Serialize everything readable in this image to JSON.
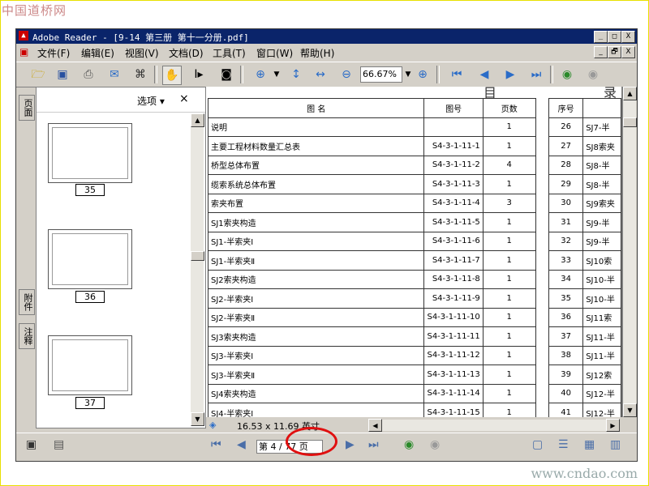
{
  "watermark_top": "中国道桥网",
  "watermark_bottom": "www.cndao.com",
  "window": {
    "title": "Adobe Reader - [9-14  第三册  第十一分册.pdf]",
    "controls": [
      "_",
      "□",
      "X"
    ],
    "doc_controls": [
      "_",
      "🗗",
      "X"
    ]
  },
  "menu": [
    "文件(F)",
    "编辑(E)",
    "视图(V)",
    "文档(D)",
    "工具(T)",
    "窗口(W)",
    "帮助(H)"
  ],
  "toolbar": {
    "zoom_value": "66.67%",
    "icons": [
      "open-folder-icon",
      "save-icon",
      "print-icon",
      "email-icon",
      "search-binoculars-icon",
      "hand-tool-icon",
      "select-text-icon",
      "snapshot-icon",
      "zoom-in-tool-icon",
      "fit-page-icon",
      "fit-width-icon",
      "zoom-out-icon",
      "zoom-in-icon",
      "first-page-icon",
      "previous-page-icon",
      "next-page-icon",
      "last-page-icon",
      "go-back-icon",
      "go-forward-icon"
    ]
  },
  "left_tabs": [
    "页面",
    "附件",
    "注释"
  ],
  "thumb_pane": {
    "options_label": "选项 ▾",
    "close_label": "×",
    "thumbs": [
      "35",
      "36",
      "37"
    ]
  },
  "toc": {
    "header_chars": [
      "目",
      "录"
    ],
    "columns": {
      "name": "图          名",
      "drawing_no": "图号",
      "pages": "页数",
      "seq": "序号"
    },
    "rows": [
      {
        "name": "说明",
        "no": "",
        "pages": "1",
        "seq": "26",
        "name2": "SJ7-半"
      },
      {
        "name": "主要工程材料数量汇总表",
        "no": "S4-3-1-11-1",
        "pages": "1",
        "seq": "27",
        "name2": "SJ8索夹"
      },
      {
        "name": "桥型总体布置",
        "no": "S4-3-1-11-2",
        "pages": "4",
        "seq": "28",
        "name2": "SJ8-半"
      },
      {
        "name": "缆索系统总体布置",
        "no": "S4-3-1-11-3",
        "pages": "1",
        "seq": "29",
        "name2": "SJ8-半"
      },
      {
        "name": "索夹布置",
        "no": "S4-3-1-11-4",
        "pages": "3",
        "seq": "30",
        "name2": "SJ9索夹"
      },
      {
        "name": "SJ1索夹构造",
        "no": "S4-3-1-11-5",
        "pages": "1",
        "seq": "31",
        "name2": "SJ9-半"
      },
      {
        "name": "SJ1-半索夹Ⅰ",
        "no": "S4-3-1-11-6",
        "pages": "1",
        "seq": "32",
        "name2": "SJ9-半"
      },
      {
        "name": "SJ1-半索夹Ⅱ",
        "no": "S4-3-1-11-7",
        "pages": "1",
        "seq": "33",
        "name2": "SJ10索"
      },
      {
        "name": "SJ2索夹构造",
        "no": "S4-3-1-11-8",
        "pages": "1",
        "seq": "34",
        "name2": "SJ10-半"
      },
      {
        "name": "SJ2-半索夹Ⅰ",
        "no": "S4-3-1-11-9",
        "pages": "1",
        "seq": "35",
        "name2": "SJ10-半"
      },
      {
        "name": "SJ2-半索夹Ⅱ",
        "no": "S4-3-1-11-10",
        "pages": "1",
        "seq": "36",
        "name2": "SJ11索"
      },
      {
        "name": "SJ3索夹构造",
        "no": "S4-3-1-11-11",
        "pages": "1",
        "seq": "37",
        "name2": "SJ11-半"
      },
      {
        "name": "SJ3-半索夹Ⅰ",
        "no": "S4-3-1-11-12",
        "pages": "1",
        "seq": "38",
        "name2": "SJ11-半"
      },
      {
        "name": "SJ3-半索夹Ⅱ",
        "no": "S4-3-1-11-13",
        "pages": "1",
        "seq": "39",
        "name2": "SJ12索"
      },
      {
        "name": "SJ4索夹构造",
        "no": "S4-3-1-11-14",
        "pages": "1",
        "seq": "40",
        "name2": "SJ12-半"
      },
      {
        "name": "SJ4-半索夹Ⅰ",
        "no": "S4-3-1-11-15",
        "pages": "1",
        "seq": "41",
        "name2": "SJ12-半"
      }
    ]
  },
  "status": {
    "page_size": "16.53 x 11.69 英寸"
  },
  "nav": {
    "page_indicator": "第 4 / 77 页"
  },
  "highlight_color": "#e01010"
}
